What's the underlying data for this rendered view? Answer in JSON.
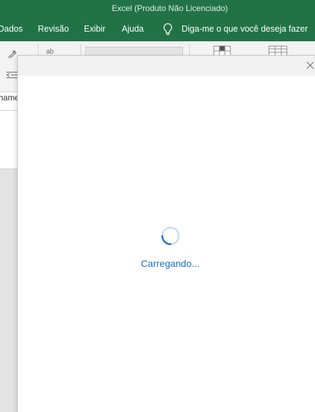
{
  "window": {
    "title": "Excel (Produto Não Licenciado)"
  },
  "ribbon": {
    "tabs": [
      {
        "label": "Dados"
      },
      {
        "label": "Revisão"
      },
      {
        "label": "Exibir"
      },
      {
        "label": "Ajuda"
      }
    ],
    "tell_me": "Diga-me o que você deseja fazer",
    "spell_label": "ab",
    "accent_color": "#217346"
  },
  "sheet": {
    "partial_text": "hame"
  },
  "dialog": {
    "loading_text": "Carregando...",
    "spinner_color": "#1e6fc1",
    "close_icon": "close-icon"
  }
}
